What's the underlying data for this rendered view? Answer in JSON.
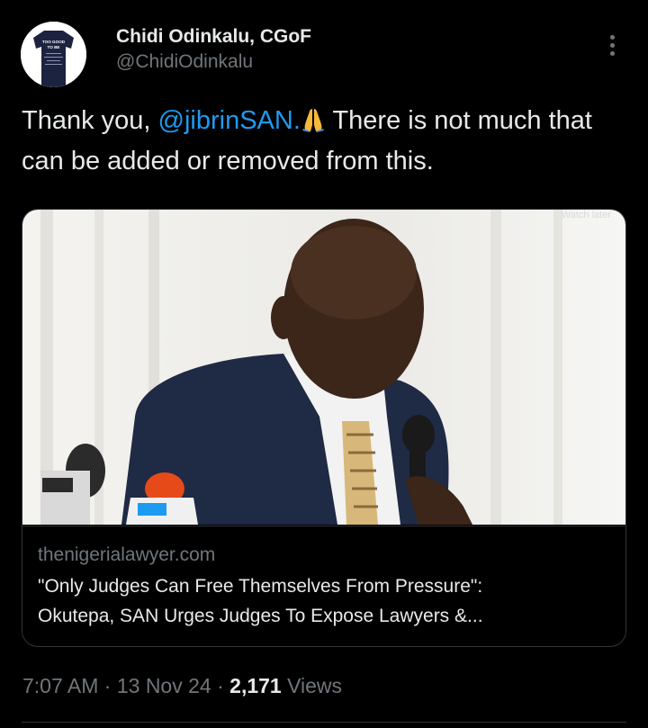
{
  "author": {
    "display_name": "Chidi Odinkalu, CGoF",
    "handle": "@ChidiOdinkalu",
    "avatar_shirt_text": [
      "TOO GOOD",
      "TO BE"
    ]
  },
  "tweet": {
    "text_before_mention": "Thank you, ",
    "mention": "@jibrinSAN",
    "text_after_mention": ".",
    "emoji": "folded-hands",
    "text_rest": " There is not much that can be added or removed from this."
  },
  "card": {
    "overlay_label": "Watch later",
    "domain": "thenigerialawyer.com",
    "title_line1": "\"Only Judges Can Free Themselves From Pressure\":",
    "title_line2": "Okutepa, SAN Urges Judges To Expose Lawyers &..."
  },
  "meta": {
    "time": "7:07 AM",
    "sep1": " · ",
    "date": "13 Nov 24",
    "sep2": " · ",
    "views_count": "2,171",
    "views_label": " Views"
  },
  "colors": {
    "background": "#000000",
    "text": "#e7e9ea",
    "muted": "#71767b",
    "link": "#1d9bf0",
    "border": "#2f3336"
  },
  "icons": {
    "more": "more-vertical-icon",
    "emoji": "folded-hands-emoji"
  }
}
